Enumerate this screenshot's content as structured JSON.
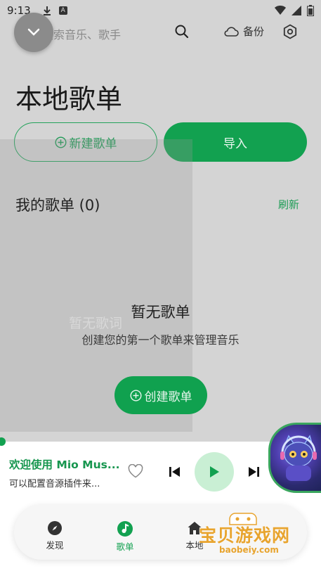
{
  "status_bar": {
    "time": "9:13"
  },
  "header": {
    "search_placeholder": "搜索音乐、歌手",
    "backup_label": "备份"
  },
  "page": {
    "title": "本地歌单",
    "new_playlist_label": "新建歌单",
    "import_label": "导入",
    "my_playlists_label": "我的歌单 (0)",
    "refresh_label": "刷新"
  },
  "empty_state": {
    "lyrics_placeholder": "暂无歌词",
    "title": "暂无歌单",
    "subtitle": "创建您的第一个歌单来管理音乐",
    "create_label": "创建歌单"
  },
  "player": {
    "title": "欢迎使用 Mio Mus...",
    "subtitle": "可以配置音源插件来..."
  },
  "nav": {
    "items": [
      {
        "label": "发现",
        "icon": "compass-icon",
        "active": false
      },
      {
        "label": "歌单",
        "icon": "music-note-icon",
        "active": true
      },
      {
        "label": "本地",
        "icon": "home-icon",
        "active": false
      }
    ]
  },
  "watermark": {
    "text": "宝贝游戏网",
    "url": "baobeiy.com"
  },
  "colors": {
    "accent": "#12a150",
    "accent_light": "#c9efd4",
    "overlay_bg": "#d4d4d4"
  }
}
